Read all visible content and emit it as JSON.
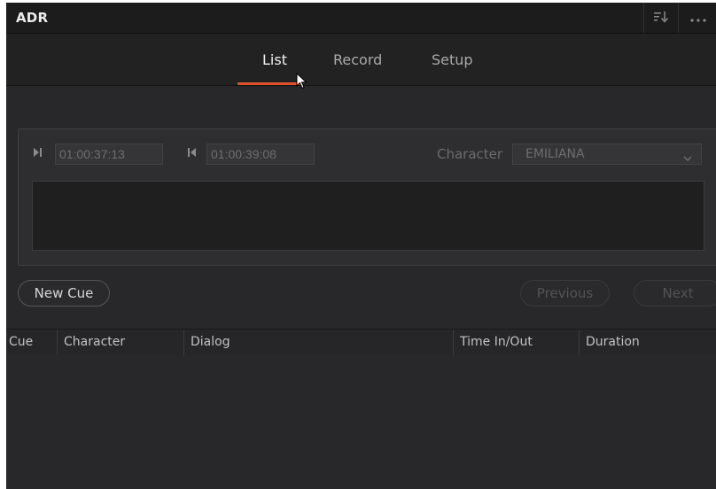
{
  "panel": {
    "title": "ADR",
    "toolbar": {
      "sort_icon": "sort-icon",
      "more_icon": "more-options-icon"
    }
  },
  "tabs": [
    {
      "label": "List",
      "active": true
    },
    {
      "label": "Record",
      "active": false
    },
    {
      "label": "Setup",
      "active": false
    }
  ],
  "cue_editor": {
    "in_icon": "mark-in-icon",
    "in_timecode": "01:00:37:13",
    "out_icon": "mark-out-icon",
    "out_timecode": "01:00:39:08",
    "character_label": "Character",
    "character_value": "EMILIANA",
    "dialog_text": ""
  },
  "buttons": {
    "new_cue": "New Cue",
    "previous": "Previous",
    "next": "Next"
  },
  "table": {
    "columns": [
      "Cue",
      "Character",
      "Dialog",
      "Time In/Out",
      "Duration"
    ],
    "rows": []
  },
  "colors": {
    "accent": "#e2502a",
    "panel_bg": "#282729"
  }
}
